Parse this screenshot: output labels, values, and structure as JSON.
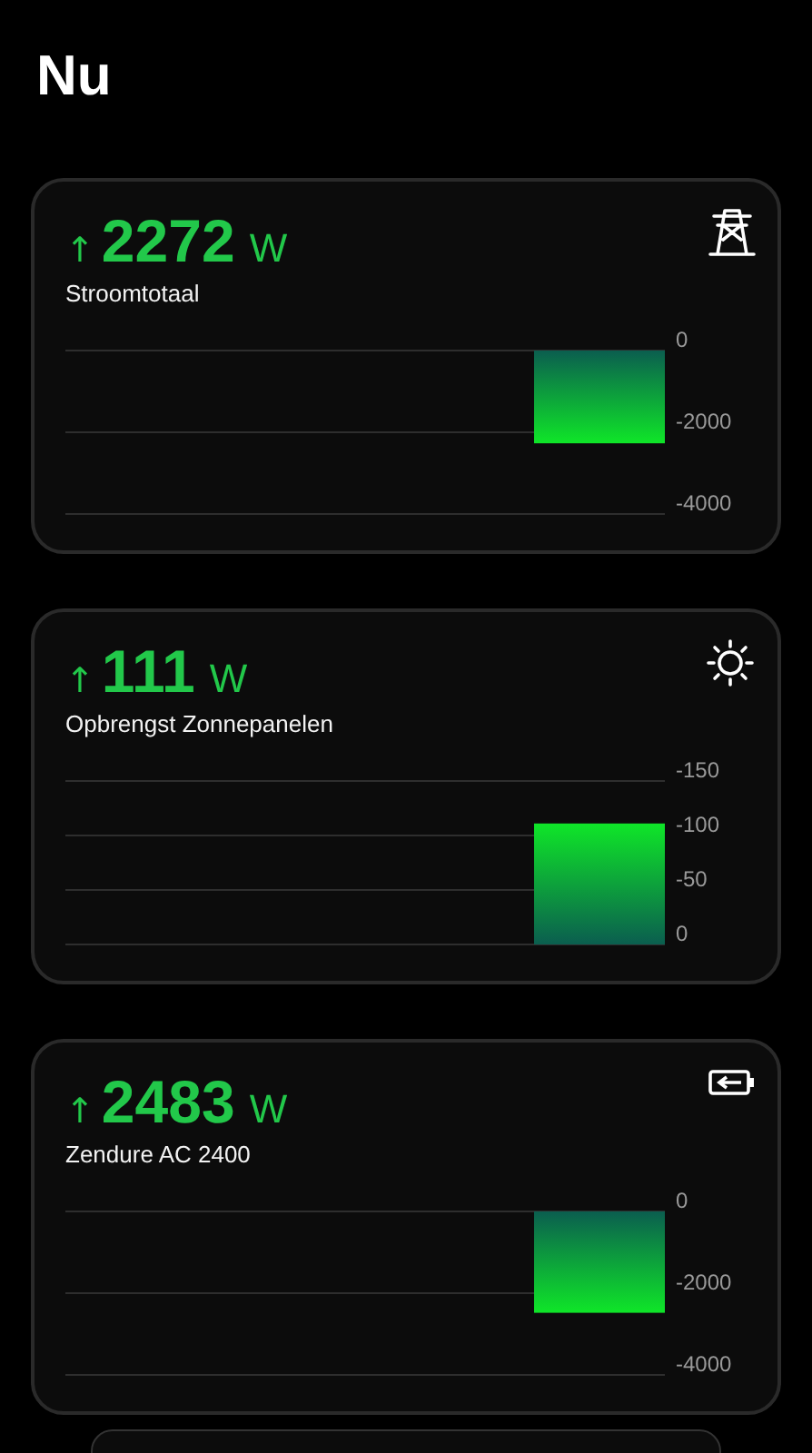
{
  "title": "Nu",
  "cards": [
    {
      "kind": "grid",
      "arrow": "↑",
      "value": "2272",
      "unit": "W",
      "label": "Stroomtotaal",
      "chart_data": {
        "type": "bar",
        "values": [
          -2270
        ],
        "ylim": [
          -4000,
          0
        ],
        "yticks": [
          0,
          -2000,
          -4000
        ]
      }
    },
    {
      "kind": "solar",
      "arrow": "↑",
      "value": "111",
      "unit": "W",
      "label": "Opbrengst Zonnepanelen",
      "chart_data": {
        "type": "bar",
        "values": [
          -111
        ],
        "ylim": [
          0,
          -150
        ],
        "yticks": [
          -150,
          -100,
          -50,
          0
        ]
      }
    },
    {
      "kind": "battery",
      "arrow": "↑",
      "value": "2483",
      "unit": "W",
      "label": "Zendure AC 2400",
      "chart_data": {
        "type": "bar",
        "values": [
          -2480
        ],
        "ylim": [
          -4000,
          0
        ],
        "yticks": [
          0,
          -2000,
          -4000
        ]
      }
    }
  ]
}
